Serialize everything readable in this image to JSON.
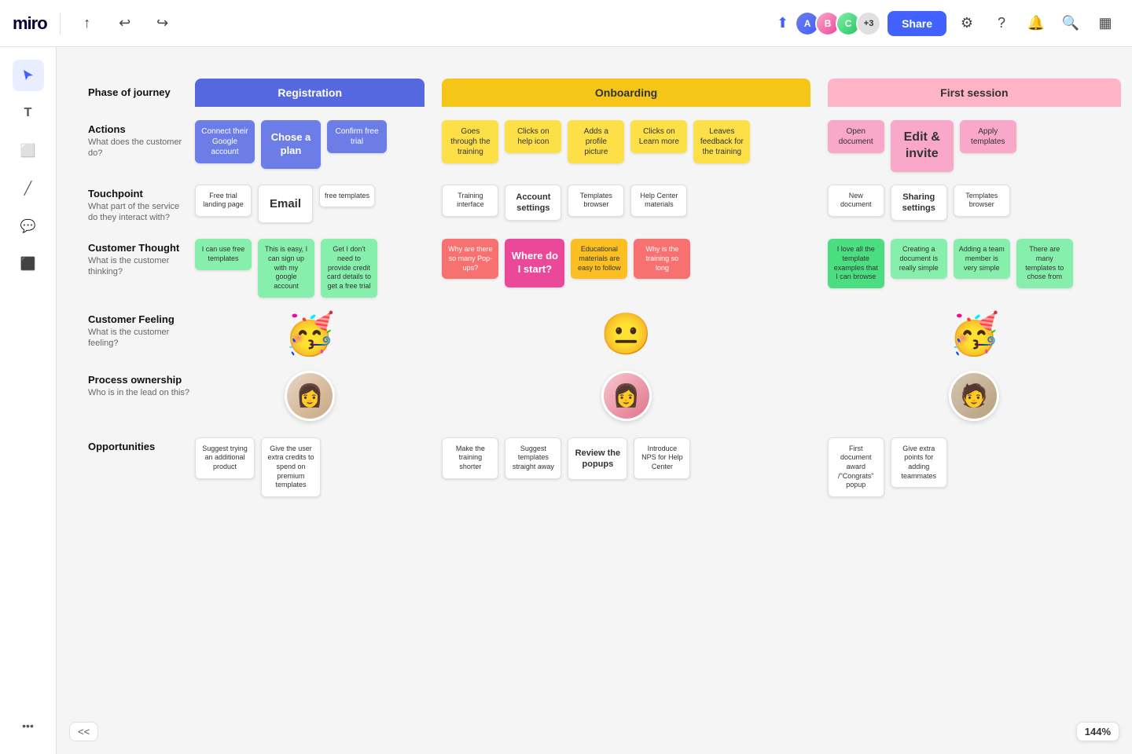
{
  "topbar": {
    "logo": "miro",
    "share_label": "Share",
    "avatar_count": "+3"
  },
  "sidebar": {
    "tools": [
      "cursor",
      "text",
      "sticky-note",
      "line",
      "comment",
      "frame",
      "more"
    ]
  },
  "phases": [
    {
      "id": "registration",
      "label": "Registration",
      "color": "registration"
    },
    {
      "id": "onboarding",
      "label": "Onboarding",
      "color": "onboarding"
    },
    {
      "id": "first_session",
      "label": "First session",
      "color": "first_session"
    }
  ],
  "rows": [
    {
      "id": "actions",
      "title": "Actions",
      "subtitle": "What does the customer do?",
      "registration_cards": [
        {
          "text": "Connect their Google account",
          "style": "blue"
        },
        {
          "text": "Chose a plan",
          "style": "blue_large"
        },
        {
          "text": "Confirm free trial",
          "style": "blue_light"
        }
      ],
      "onboarding_cards": [
        {
          "text": "Goes through the training",
          "style": "yellow"
        },
        {
          "text": "Clicks on help icon",
          "style": "yellow"
        },
        {
          "text": "Adds a profile picture",
          "style": "yellow"
        },
        {
          "text": "Clicks on Learn more",
          "style": "yellow"
        },
        {
          "text": "Leaves feedback for the training",
          "style": "yellow"
        }
      ],
      "first_session_cards": [
        {
          "text": "Open document",
          "style": "pink"
        },
        {
          "text": "Edit & invite",
          "style": "pink_xl"
        },
        {
          "text": "Apply templates",
          "style": "pink"
        }
      ]
    },
    {
      "id": "touchpoint",
      "title": "Touchpoint",
      "subtitle": "What part of the service do they interact with?",
      "registration_cards": [
        {
          "text": "Free trial landing page",
          "style": "white_small"
        },
        {
          "text": "Email",
          "style": "white_large"
        },
        {
          "text": "free templates",
          "style": "white_small"
        }
      ],
      "onboarding_cards": [
        {
          "text": "Training interface",
          "style": "white_small"
        },
        {
          "text": "Account settings",
          "style": "white_medium"
        },
        {
          "text": "Templates browser",
          "style": "white_small"
        },
        {
          "text": "Help Center materials",
          "style": "white_small"
        }
      ],
      "first_session_cards": [
        {
          "text": "New document",
          "style": "white_small"
        },
        {
          "text": "Sharing settings",
          "style": "white_medium"
        },
        {
          "text": "Templates browser",
          "style": "white_small"
        }
      ]
    },
    {
      "id": "customer_thought",
      "title": "Customer Thought",
      "subtitle": "What is the customer thinking?",
      "registration_cards": [
        {
          "text": "I can use free templates",
          "style": "green"
        },
        {
          "text": "This is easy, I can sign up with my google account",
          "style": "green"
        },
        {
          "text": "Get I don't need to provide credit card details to get a free trial",
          "style": "green"
        }
      ],
      "onboarding_cards": [
        {
          "text": "Why are there so many Pop-ups?",
          "style": "pink2"
        },
        {
          "text": "Where do I start?",
          "style": "pink2_large"
        },
        {
          "text": "Educational materials are easy to follow",
          "style": "yellow2"
        },
        {
          "text": "Why is the training so long",
          "style": "pink2"
        }
      ],
      "first_session_cards": [
        {
          "text": "I love all the template examples that I can browse",
          "style": "green2"
        },
        {
          "text": "Creating a document is really simple",
          "style": "green"
        },
        {
          "text": "Adding a team member is very simple",
          "style": "green"
        },
        {
          "text": "There are many templates to chose from",
          "style": "green"
        }
      ]
    },
    {
      "id": "customer_feeling",
      "title": "Customer Feeling",
      "subtitle": "What is the customer feeling?",
      "emojis": {
        "registration": "🥳",
        "onboarding": "😐",
        "first_session": "🥳"
      }
    },
    {
      "id": "process_ownership",
      "title": "Process ownership",
      "subtitle": "Who is in the lead on this?",
      "people": {
        "registration": "person-a",
        "onboarding": "person-b",
        "first_session": "person-c"
      }
    },
    {
      "id": "opportunities",
      "title": "Opportunities",
      "subtitle": "",
      "registration_cards": [
        {
          "text": "Suggest trying an additional product",
          "style": "white_opp"
        },
        {
          "text": "Give the user extra credits to spend on premium templates",
          "style": "white_opp"
        }
      ],
      "onboarding_cards": [
        {
          "text": "Make the training shorter",
          "style": "white_opp"
        },
        {
          "text": "Suggest templates straight away",
          "style": "white_opp"
        },
        {
          "text": "Review the popups",
          "style": "white_opp_large"
        },
        {
          "text": "Introduce NPS for Help Center",
          "style": "white_opp"
        }
      ],
      "first_session_cards": [
        {
          "text": "First document award /\"Congrats\" popup",
          "style": "white_opp"
        },
        {
          "text": "Give extra points for adding teammates",
          "style": "white_opp"
        }
      ]
    }
  ],
  "zoom": "144%",
  "collapse_label": "<<"
}
